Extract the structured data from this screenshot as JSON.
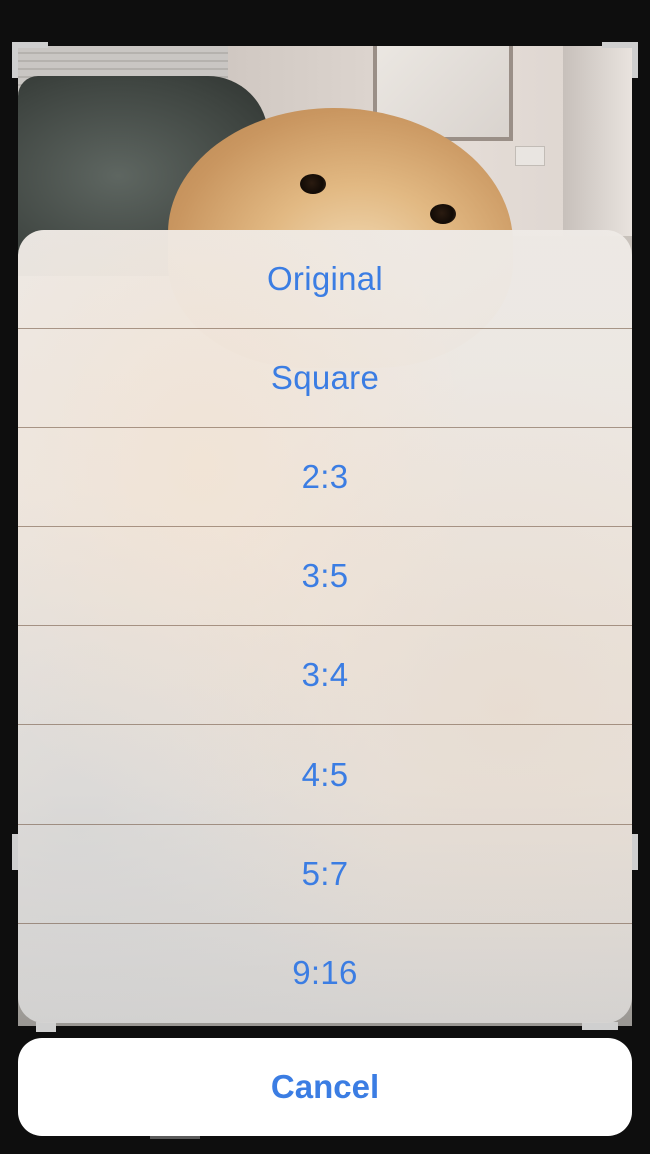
{
  "aspect_sheet": {
    "options": [
      {
        "label": "Original"
      },
      {
        "label": "Square"
      },
      {
        "label": "2:3"
      },
      {
        "label": "3:5"
      },
      {
        "label": "3:4"
      },
      {
        "label": "4:5"
      },
      {
        "label": "5:7"
      },
      {
        "label": "9:16"
      }
    ],
    "cancel_label": "Cancel"
  },
  "colors": {
    "accent": "#3b7de3",
    "background": "#0e0e0e",
    "cancel_bg": "#ffffff"
  }
}
